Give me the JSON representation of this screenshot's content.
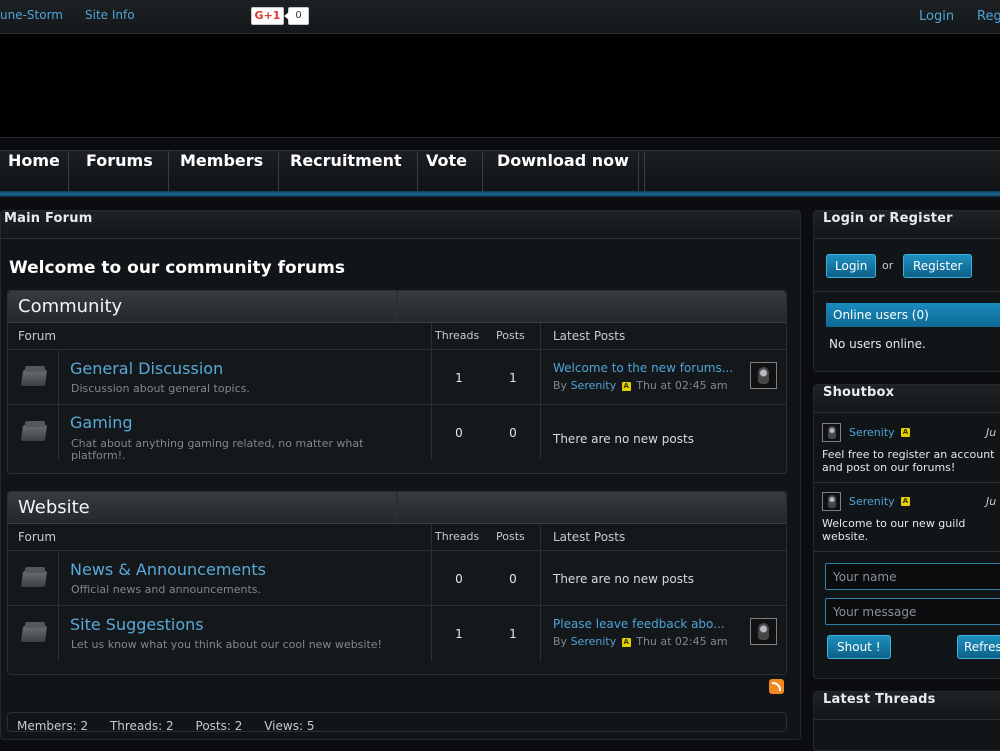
{
  "topbar": {
    "links": [
      "une-Storm",
      "Site Info"
    ],
    "gplus_label": "G+1",
    "gplus_count": "0",
    "login": "Login",
    "register": "Reg"
  },
  "nav": [
    "Home",
    "Forums",
    "Members",
    "Recruitment",
    "Vote",
    "Download now"
  ],
  "main": {
    "panel_title": "Main Forum",
    "welcome": "Welcome to our community forums",
    "columns": {
      "forum": "Forum",
      "threads": "Threads",
      "posts": "Posts",
      "latest": "Latest Posts"
    },
    "categories": [
      {
        "title": "Community",
        "forums": [
          {
            "name": "General Discussion",
            "desc": "Discussion about general topics.",
            "threads": "1",
            "posts": "1",
            "latest_title": "Welcome to the new forums...",
            "latest_by": "By",
            "latest_user": "Serenity",
            "latest_rank": "A",
            "latest_time": "Thu at 02:45 am",
            "no_posts": ""
          },
          {
            "name": "Gaming",
            "desc": "Chat about anything gaming related, no matter what platform!.",
            "threads": "0",
            "posts": "0",
            "latest_title": "",
            "latest_by": "",
            "latest_user": "",
            "latest_rank": "",
            "latest_time": "",
            "no_posts": "There are no new posts"
          }
        ]
      },
      {
        "title": "Website",
        "forums": [
          {
            "name": "News & Announcements",
            "desc": "Official news and announcements.",
            "threads": "0",
            "posts": "0",
            "latest_title": "",
            "latest_by": "",
            "latest_user": "",
            "latest_rank": "",
            "latest_time": "",
            "no_posts": "There are no new posts"
          },
          {
            "name": "Site Suggestions",
            "desc": "Let us know what you think about our cool new website!",
            "threads": "1",
            "posts": "1",
            "latest_title": "Please leave feedback abo...",
            "latest_by": "By",
            "latest_user": "Serenity",
            "latest_rank": "A",
            "latest_time": "Thu at 02:45 am",
            "no_posts": ""
          }
        ]
      }
    ],
    "stats": {
      "members_label": "Members:",
      "members": "2",
      "threads_label": "Threads:",
      "threads": "2",
      "posts_label": "Posts:",
      "posts": "2",
      "views_label": "Views:",
      "views": "5"
    }
  },
  "sidebar": {
    "login_title": "Login or Register",
    "login_button": "Login",
    "or_text": "or",
    "register_button": "Register",
    "online_title": "Online users (0)",
    "online_text": "No users online.",
    "shoutbox_title": "Shoutbox",
    "shouts": [
      {
        "user": "Serenity",
        "rank": "A",
        "date": "Ju",
        "message": "Feel free to register an account and post on our forums!"
      },
      {
        "user": "Serenity",
        "rank": "A",
        "date": "Ju",
        "message": "Welcome to our new guild website."
      }
    ],
    "name_placeholder": "Your name",
    "message_placeholder": "Your message",
    "shout_button": "Shout !",
    "refresh_button": "Refresh",
    "latest_threads_title": "Latest Threads"
  }
}
